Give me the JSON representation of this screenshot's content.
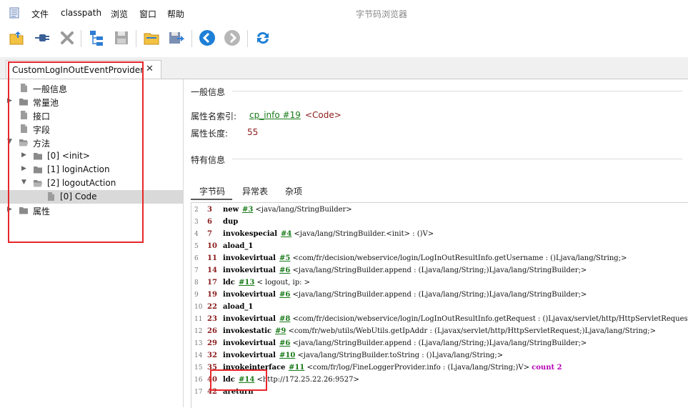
{
  "app": {
    "window_title": "字节码浏览器",
    "menu": [
      "文件",
      "classpath",
      "浏览",
      "窗口",
      "帮助"
    ]
  },
  "tab": {
    "label": "CustomLogInOutEventProvider",
    "close": "✕"
  },
  "tree": [
    {
      "label": "一般信息",
      "icon": "file-icon",
      "indent": 0,
      "arrow": ""
    },
    {
      "label": "常量池",
      "icon": "folder-icon",
      "indent": 0,
      "arrow": "▶"
    },
    {
      "label": "接口",
      "icon": "file-icon",
      "indent": 0,
      "arrow": ""
    },
    {
      "label": "字段",
      "icon": "file-icon",
      "indent": 0,
      "arrow": ""
    },
    {
      "label": "方法",
      "icon": "folder-open-icon",
      "indent": 0,
      "arrow": "▼"
    },
    {
      "label": "[0] <init>",
      "icon": "folder-icon",
      "indent": 1,
      "arrow": "▶"
    },
    {
      "label": "[1] loginAction",
      "icon": "folder-icon",
      "indent": 1,
      "arrow": "▶"
    },
    {
      "label": "[2] logoutAction",
      "icon": "folder-open-icon",
      "indent": 1,
      "arrow": "▼"
    },
    {
      "label": "[0] Code",
      "icon": "file-icon",
      "indent": 2,
      "arrow": "",
      "selected": true
    },
    {
      "label": "属性",
      "icon": "folder-icon",
      "indent": 0,
      "arrow": "▶"
    }
  ],
  "general": {
    "title": "一般信息",
    "name_index_label": "属性名索引:",
    "name_index_link": "cp_info #19",
    "name_index_value": "<Code>",
    "length_label": "属性长度:",
    "length_value": "55"
  },
  "specific": {
    "title": "特有信息"
  },
  "subtabs": [
    "字节码",
    "异常表",
    "杂项"
  ],
  "code": [
    {
      "ln": "2",
      "off": "3",
      "instr": "new",
      "ref": "#3",
      "arg": " <java/lang/StringBuilder>",
      "kw": ""
    },
    {
      "ln": "3",
      "off": "6",
      "instr": "dup",
      "ref": "",
      "arg": "",
      "kw": ""
    },
    {
      "ln": "4",
      "off": "7",
      "instr": "invokespecial",
      "ref": "#4",
      "arg": " <java/lang/StringBuilder.<init> : ()V>",
      "kw": ""
    },
    {
      "ln": "5",
      "off": "10",
      "instr": "aload_1",
      "ref": "",
      "arg": "",
      "kw": ""
    },
    {
      "ln": "6",
      "off": "11",
      "instr": "invokevirtual",
      "ref": "#5",
      "arg": " <com/fr/decision/webservice/login/LogInOutResultInfo.getUsername : ()Ljava/lang/String;>",
      "kw": ""
    },
    {
      "ln": "7",
      "off": "14",
      "instr": "invokevirtual",
      "ref": "#6",
      "arg": " <java/lang/StringBuilder.append : (Ljava/lang/String;)Ljava/lang/StringBuilder;>",
      "kw": ""
    },
    {
      "ln": "8",
      "off": "17",
      "instr": "ldc",
      "ref": "#13",
      "arg": " < logout, ip: >",
      "kw": ""
    },
    {
      "ln": "9",
      "off": "19",
      "instr": "invokevirtual",
      "ref": "#6",
      "arg": " <java/lang/StringBuilder.append : (Ljava/lang/String;)Ljava/lang/StringBuilder;>",
      "kw": ""
    },
    {
      "ln": "10",
      "off": "22",
      "instr": "aload_1",
      "ref": "",
      "arg": "",
      "kw": ""
    },
    {
      "ln": "11",
      "off": "23",
      "instr": "invokevirtual",
      "ref": "#8",
      "arg": " <com/fr/decision/webservice/login/LogInOutResultInfo.getRequest : ()Ljavax/servlet/http/HttpServletRequest;>",
      "kw": ""
    },
    {
      "ln": "12",
      "off": "26",
      "instr": "invokestatic",
      "ref": "#9",
      "arg": " <com/fr/web/utils/WebUtils.getIpAddr : (Ljavax/servlet/http/HttpServletRequest;)Ljava/lang/String;>",
      "kw": ""
    },
    {
      "ln": "13",
      "off": "29",
      "instr": "invokevirtual",
      "ref": "#6",
      "arg": " <java/lang/StringBuilder.append : (Ljava/lang/String;)Ljava/lang/StringBuilder;>",
      "kw": ""
    },
    {
      "ln": "14",
      "off": "32",
      "instr": "invokevirtual",
      "ref": "#10",
      "arg": " <java/lang/StringBuilder.toString : ()Ljava/lang/String;>",
      "kw": ""
    },
    {
      "ln": "15",
      "off": "35",
      "instr": "invokeinterface",
      "ref": "#11",
      "arg": " <com/fr/log/FineLoggerProvider.info : (Ljava/lang/String;)V> ",
      "kw": "count 2"
    },
    {
      "ln": "16",
      "off": "40",
      "instr": "ldc",
      "ref": "#14",
      "arg": " <http://172.25.22.26:9527>",
      "kw": ""
    },
    {
      "ln": "17",
      "off": "42",
      "instr": "areturn",
      "ref": "",
      "arg": "",
      "kw": ""
    }
  ],
  "colors": {
    "annotation": "#e8262a",
    "offset": "#8b1a1a",
    "reference": "#1a7a1a",
    "keyword": "#b400b4"
  }
}
